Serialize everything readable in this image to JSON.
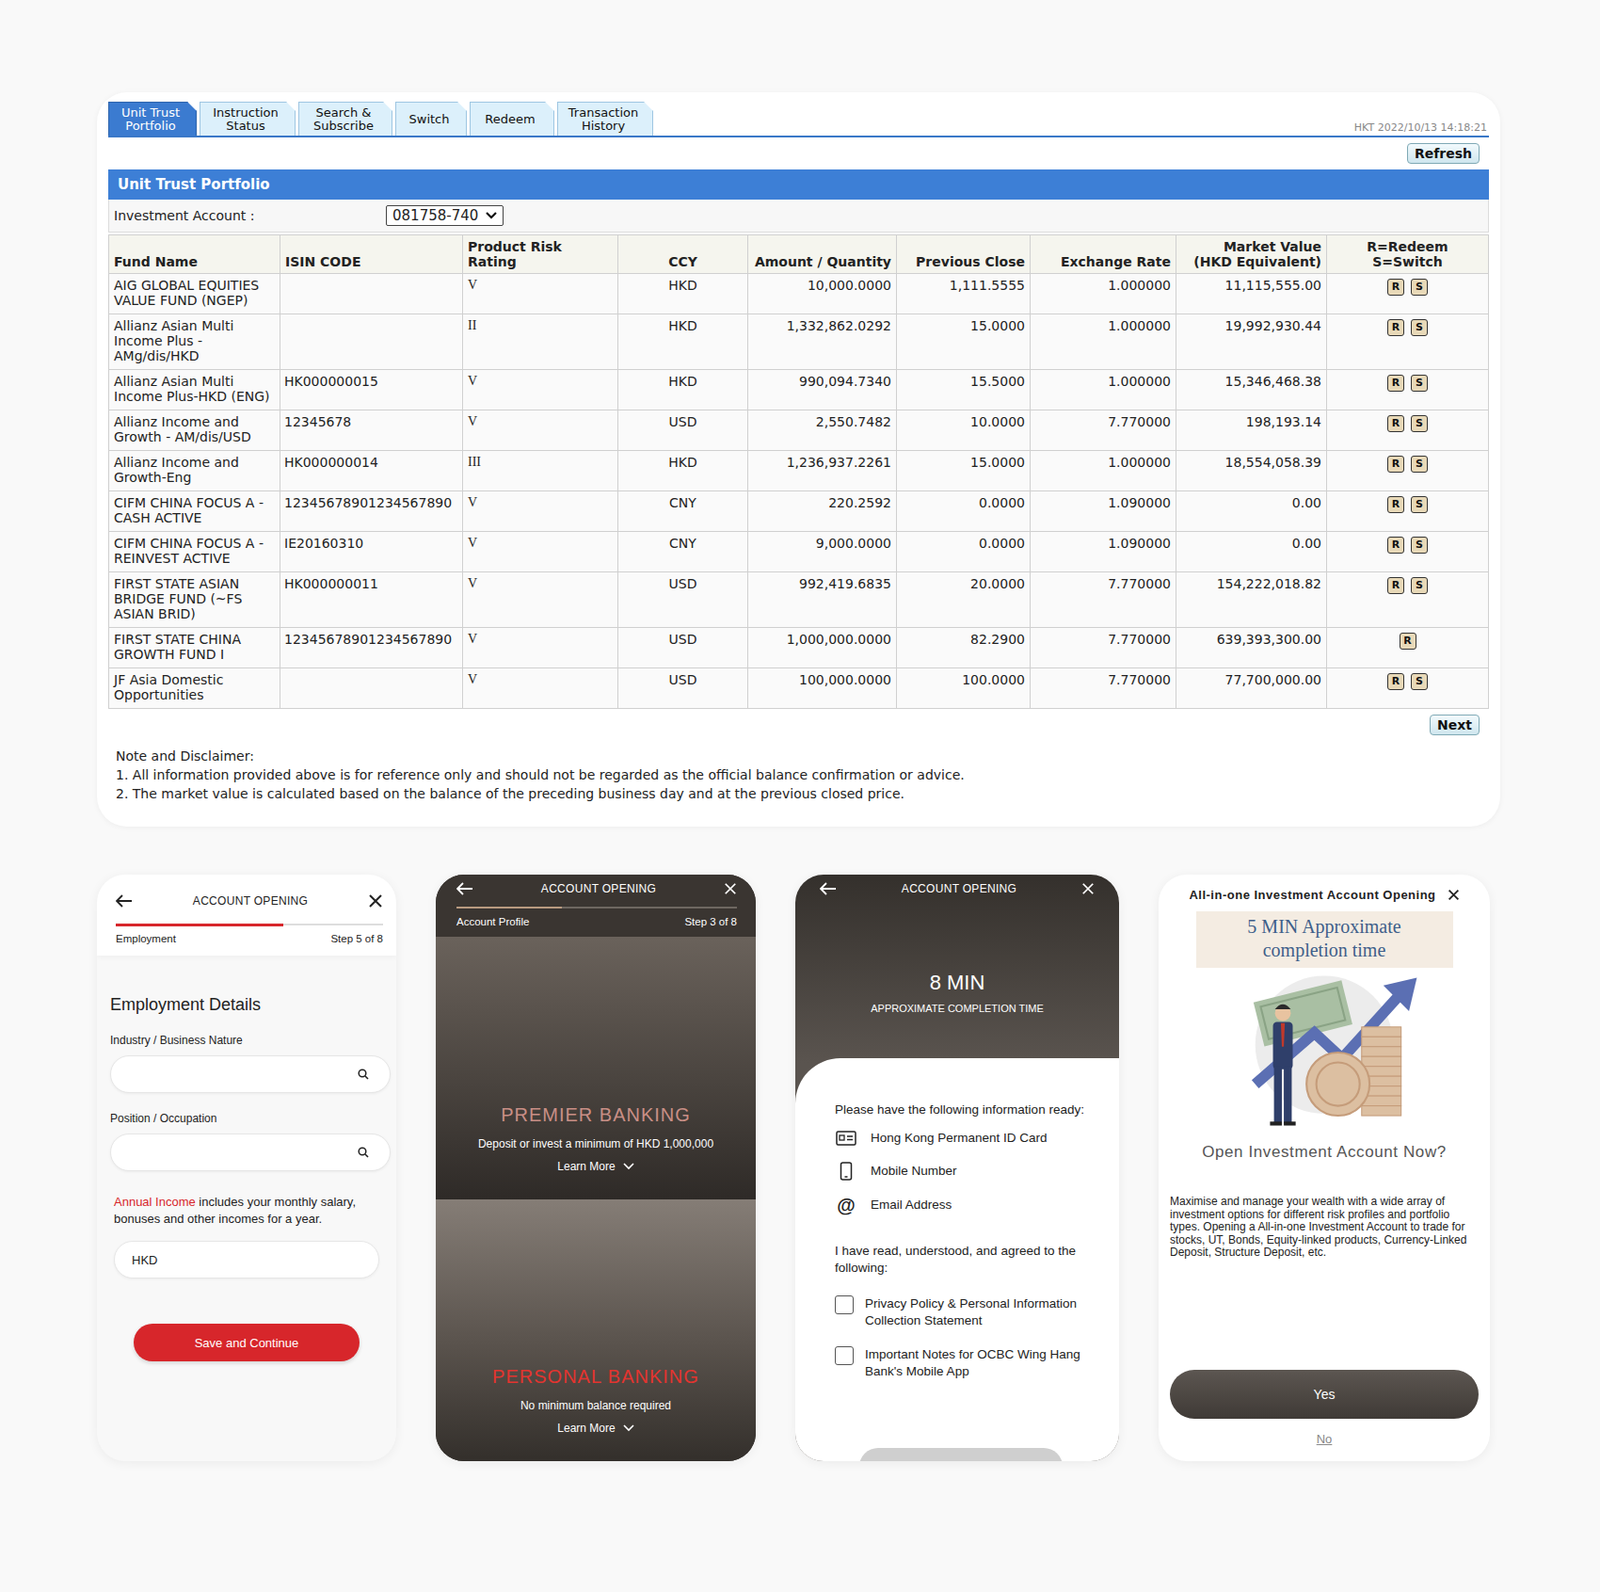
{
  "portfolio": {
    "tabs": [
      {
        "label": "Unit Trust Portfolio",
        "selected": true
      },
      {
        "label": "Instruction Status",
        "selected": false
      },
      {
        "label": "Search & Subscribe",
        "selected": false
      },
      {
        "label": "Switch",
        "selected": false
      },
      {
        "label": "Redeem",
        "selected": false
      },
      {
        "label": "Transaction History",
        "selected": false
      }
    ],
    "timestamp": "HKT 2022/10/13 14:18:21",
    "refresh_button": "Refresh",
    "title": "Unit Trust Portfolio",
    "account": {
      "label": "Investment Account :",
      "value": "081758-740"
    },
    "table": {
      "columns": [
        "Fund Name",
        "ISIN CODE",
        "Product Risk Rating",
        "CCY",
        "Amount / Quantity",
        "Previous Close",
        "Exchange Rate",
        "Market Value (HKD Equivalent)",
        "R=Redeem S=Switch"
      ],
      "rows": [
        {
          "fund": "AIG GLOBAL EQUITIES VALUE FUND (NGEP)",
          "isin": "",
          "risk": "V",
          "ccy": "HKD",
          "amount": "10,000.0000",
          "previous_close": "1,111.5555",
          "exchange_rate": "1.000000",
          "market_value": "11,115,555.00",
          "actions": [
            "R",
            "S"
          ]
        },
        {
          "fund": "Allianz Asian Multi Income Plus - AMg/dis/HKD",
          "isin": "",
          "risk": "II",
          "ccy": "HKD",
          "amount": "1,332,862.0292",
          "previous_close": "15.0000",
          "exchange_rate": "1.000000",
          "market_value": "19,992,930.44",
          "actions": [
            "R",
            "S"
          ]
        },
        {
          "fund": "Allianz Asian Multi Income Plus-HKD (ENG)",
          "isin": "HK000000015",
          "risk": "V",
          "ccy": "HKD",
          "amount": "990,094.7340",
          "previous_close": "15.5000",
          "exchange_rate": "1.000000",
          "market_value": "15,346,468.38",
          "actions": [
            "R",
            "S"
          ]
        },
        {
          "fund": "Allianz Income and Growth - AM/dis/USD",
          "isin": "12345678",
          "risk": "V",
          "ccy": "USD",
          "amount": "2,550.7482",
          "previous_close": "10.0000",
          "exchange_rate": "7.770000",
          "market_value": "198,193.14",
          "actions": [
            "R",
            "S"
          ]
        },
        {
          "fund": "Allianz Income and Growth-Eng",
          "isin": "HK000000014",
          "risk": "III",
          "ccy": "HKD",
          "amount": "1,236,937.2261",
          "previous_close": "15.0000",
          "exchange_rate": "1.000000",
          "market_value": "18,554,058.39",
          "actions": [
            "R",
            "S"
          ]
        },
        {
          "fund": "CIFM CHINA FOCUS A - CASH ACTIVE",
          "isin": "12345678901234567890",
          "risk": "V",
          "ccy": "CNY",
          "amount": "220.2592",
          "previous_close": "0.0000",
          "exchange_rate": "1.090000",
          "market_value": "0.00",
          "actions": [
            "R",
            "S"
          ]
        },
        {
          "fund": "CIFM CHINA FOCUS A - REINVEST ACTIVE",
          "isin": "IE20160310",
          "risk": "V",
          "ccy": "CNY",
          "amount": "9,000.0000",
          "previous_close": "0.0000",
          "exchange_rate": "1.090000",
          "market_value": "0.00",
          "actions": [
            "R",
            "S"
          ]
        },
        {
          "fund": "FIRST STATE ASIAN BRIDGE FUND (~FS ASIAN BRID)",
          "isin": "HK000000011",
          "risk": "V",
          "ccy": "USD",
          "amount": "992,419.6835",
          "previous_close": "20.0000",
          "exchange_rate": "7.770000",
          "market_value": "154,222,018.82",
          "actions": [
            "R",
            "S"
          ]
        },
        {
          "fund": "FIRST STATE CHINA GROWTH FUND I",
          "isin": "12345678901234567890",
          "risk": "V",
          "ccy": "USD",
          "amount": "1,000,000.0000",
          "previous_close": "82.2900",
          "exchange_rate": "7.770000",
          "market_value": "639,393,300.00",
          "actions": [
            "R"
          ]
        },
        {
          "fund": "JF Asia Domestic Opportunities",
          "isin": "",
          "risk": "V",
          "ccy": "USD",
          "amount": "100,000.0000",
          "previous_close": "100.0000",
          "exchange_rate": "7.770000",
          "market_value": "77,700,000.00",
          "actions": [
            "R",
            "S"
          ]
        }
      ]
    },
    "next_button": "Next",
    "notes": {
      "title": "Note and Disclaimer:",
      "lines": [
        "1. All information provided above is for reference only and should not be regarded as the official balance confirmation or advice.",
        "2. The market value is calculated based on the balance of the preceding business day and at the previous closed price."
      ]
    }
  },
  "employment_screen": {
    "header": "ACCOUNT OPENING",
    "step_name": "Employment",
    "step_count": "Step 5 of 8",
    "progress": {
      "level": 0.625
    },
    "heading": "Employment Details",
    "fields": [
      {
        "label": "Industry / Business Nature",
        "value": ""
      },
      {
        "label": "Position / Occupation",
        "value": ""
      }
    ],
    "income_note": {
      "highlight": "Annual Income",
      "rest": " includes your monthly salary, bonuses and other incomes for a year."
    },
    "income_field": {
      "value": "HKD"
    },
    "button": "Save and Continue"
  },
  "profile_screen": {
    "header": "ACCOUNT OPENING",
    "step_name": "Account Profile",
    "step_count": "Step 3 of 8",
    "progress": {
      "level": 0.375
    },
    "options": [
      {
        "title": "PREMIER BANKING",
        "subtitle": "Deposit or invest a minimum of HKD 1,000,000",
        "link": "Learn More",
        "color": "#c98f86"
      },
      {
        "title": "PERSONAL BANKING",
        "subtitle": "No minimum balance required",
        "link": "Learn More",
        "color": "#e3342f"
      }
    ]
  },
  "checklist_screen": {
    "header": "ACCOUNT OPENING",
    "time": "8 MIN",
    "time_caption": "APPROXIMATE COMPLETION TIME",
    "prompt": "Please have the following information ready:",
    "items": [
      {
        "kind": "id-card",
        "glyph": "",
        "label": "Hong Kong Permanent ID Card"
      },
      {
        "kind": "phone",
        "glyph": "",
        "label": "Mobile Number"
      },
      {
        "kind": "glyph",
        "glyph": "@",
        "label": "Email Address"
      }
    ],
    "agree_prompt": "I have read, understood, and agreed to the following:",
    "agreements": [
      {
        "label": "Privacy Policy & Personal Information Collection Statement",
        "checked": false
      },
      {
        "label": "Important Notes for OCBC Wing Hang Bank's Mobile App",
        "checked": false
      }
    ]
  },
  "invest_prompt_screen": {
    "title": "All-in-one Investment Account Opening",
    "banner_lines": [
      "5 MIN Approximate",
      "completion time"
    ],
    "question": "Open Investment Account Now?",
    "description": "Maximise and manage your wealth with a wide array of investment options for different risk profiles and portfolio types. Opening a All-in-one Investment Account to trade for stocks, UT, Bonds, Equity-linked products, Currency-Linked Deposit, Structure Deposit, etc.",
    "yes_button": "Yes",
    "no_button": "No"
  }
}
